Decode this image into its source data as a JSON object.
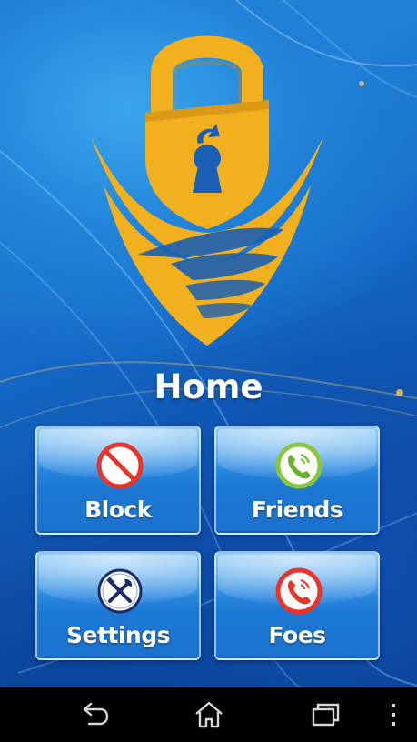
{
  "screen": {
    "title": "Home"
  },
  "tiles": [
    {
      "id": "block",
      "label": "Block",
      "icon": "block-icon",
      "ring_color": "#e8342a"
    },
    {
      "id": "friends",
      "label": "Friends",
      "icon": "phone-accept-icon",
      "ring_color": "#8cc63f"
    },
    {
      "id": "settings",
      "label": "Settings",
      "icon": "tools-icon",
      "ring_color": "#1a2c6e"
    },
    {
      "id": "foes",
      "label": "Foes",
      "icon": "phone-reject-icon",
      "ring_color": "#e8342a"
    }
  ],
  "navbar": {
    "buttons": [
      "back-icon",
      "home-icon",
      "recent-apps-icon",
      "overflow-menu-icon"
    ]
  },
  "colors": {
    "logo_gold": "#f2b01e",
    "logo_shadow": "#c98a10",
    "background_blue": "#1a72cd"
  }
}
